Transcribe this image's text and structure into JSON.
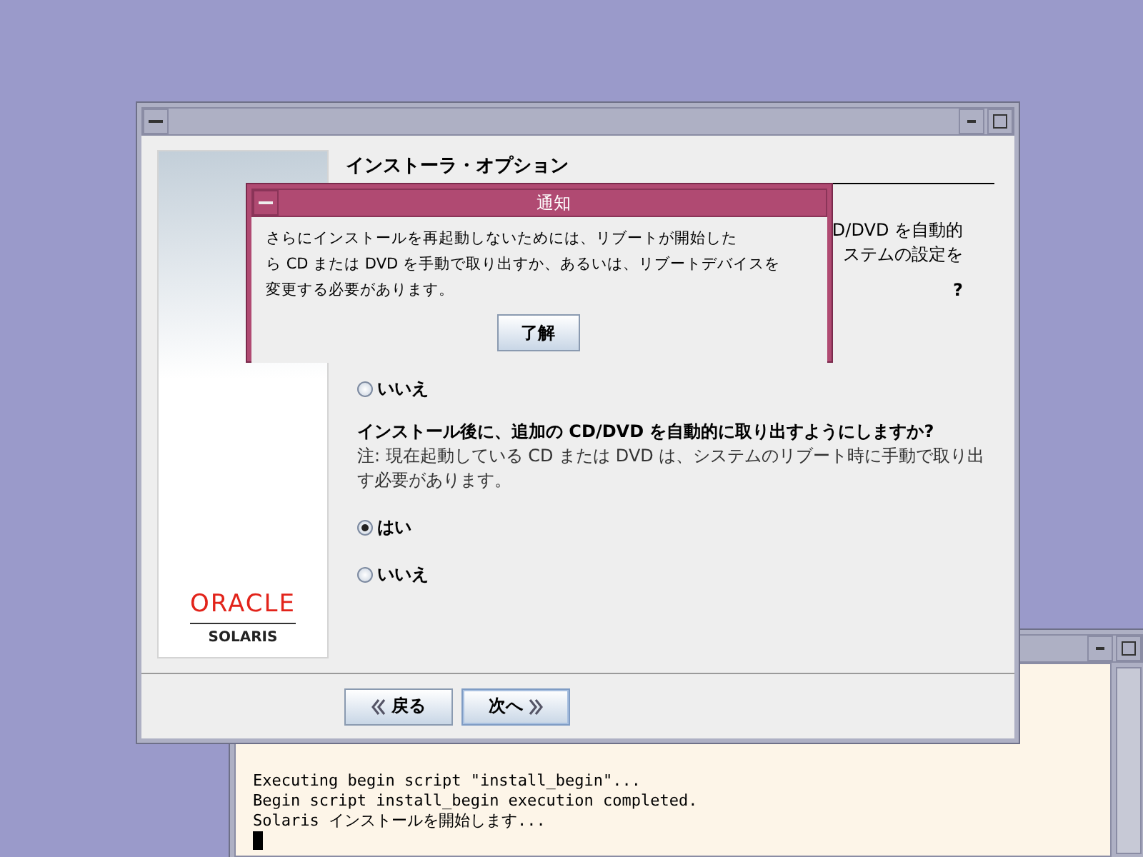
{
  "installer": {
    "heading": "インストーラ・オプション",
    "obscured_lines": [
      "D/DVD を自動的",
      "ステムの設定を"
    ],
    "obscured_question": "?",
    "options_1": [
      {
        "label": "いいえ",
        "selected": false
      }
    ],
    "question": "インストール後に、追加の CD/DVD を自動的に取り出すようにしますか?",
    "note": "注: 現在起動している CD または DVD は、システムのリブート時に手動で取り出す必要があります。",
    "options_2": [
      {
        "label": "はい",
        "selected": true
      },
      {
        "label": "いいえ",
        "selected": false
      }
    ],
    "logo": {
      "brand": "ORACLE",
      "product": "SOLARIS"
    },
    "buttons": [
      {
        "label": "戻る",
        "kind": "back"
      },
      {
        "label": "次へ",
        "kind": "next"
      }
    ]
  },
  "dialog": {
    "title": "通知",
    "lines": [
      "さらにインストールを再起動しないためには、リブートが開始した",
      "ら CD または DVD を手動で取り出すか、あるいは、リブートデバイスを",
      "変更する必要があります。"
    ],
    "button": "了解"
  },
  "terminal": {
    "lines": [
      "Executing begin script \"install_begin\"...",
      "Begin script install_begin execution completed.",
      "Solaris インストールを開始します..."
    ]
  }
}
